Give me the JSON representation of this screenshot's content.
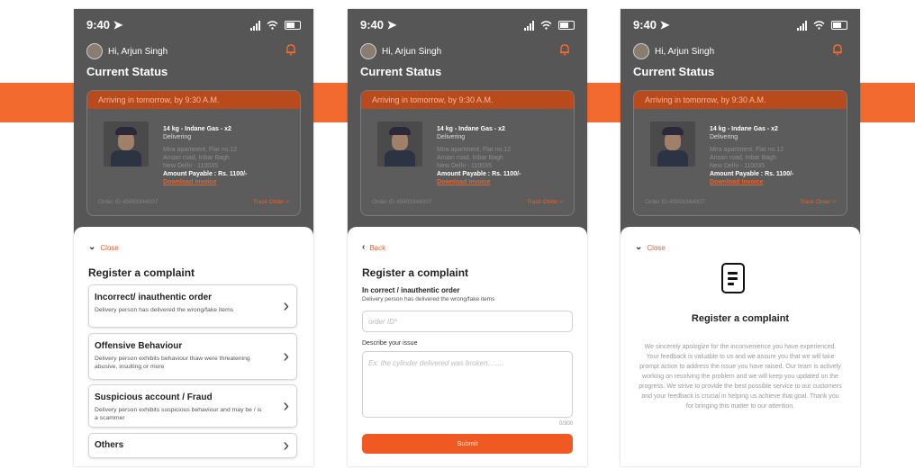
{
  "status": {
    "time": "9:40"
  },
  "header": {
    "greeting": "Hi, Arjun Singh"
  },
  "current_status": {
    "title": "Current Status",
    "arrival": "Arriving in tomorrow, by 9:30 A.M.",
    "product": "14 kg - Indane Gas - x2",
    "state": "Delivering",
    "address_lines": [
      "Mira apartment, Flat no.12",
      "Ansari road, Inbar Bagh",
      "New Delhi - 110035"
    ],
    "amount": "Amount Payable : Rs. 1100/-",
    "download": "Download Invoice",
    "order_id": "Order ID 45903344007",
    "track": "Track Order >"
  },
  "screen1": {
    "close": "Close",
    "title": "Register a complaint",
    "options": [
      {
        "title": "Incorrect/ inauthentic order",
        "desc": "Delivery person has delivered the wrong/fake items"
      },
      {
        "title": "Offensive Behaviour",
        "desc": "Delivery person exhibits behaviour thaw were threatening abusive, insulting or more"
      },
      {
        "title": "Suspicious account / Fraud",
        "desc": "Delivery person exhibits suspicious behaviour and may be / is a scammer"
      },
      {
        "title": "Others",
        "desc": ""
      }
    ]
  },
  "screen2": {
    "back": "Back",
    "title": "Register a complaint",
    "subtitle": "In correct / inauthentic order",
    "subdesc": "Delivery person has delivered the wrong/fake items",
    "order_placeholder": "order ID*",
    "issue_label": "Describe your issue",
    "issue_placeholder": "Ex. the cylinder delivered was broken........",
    "char_count": "0/300",
    "submit": "Submit"
  },
  "screen3": {
    "close": "Close",
    "title": "Register a complaint",
    "message": "We sincerely apologize for the inconvenience you have experienced. Your feedback is valuable to us and we assure you that we will take prompt action to address the issue you have raised. Our team is actively working on resolving the problem and we will keep you updated on the progress. We strive to provide the best possible service to our customers and your feedback is crucial in helping us achieve that goal. Thank you for bringing this matter to our attention."
  },
  "colors": {
    "accent": "#f26a2e",
    "overlay": "#565656"
  }
}
